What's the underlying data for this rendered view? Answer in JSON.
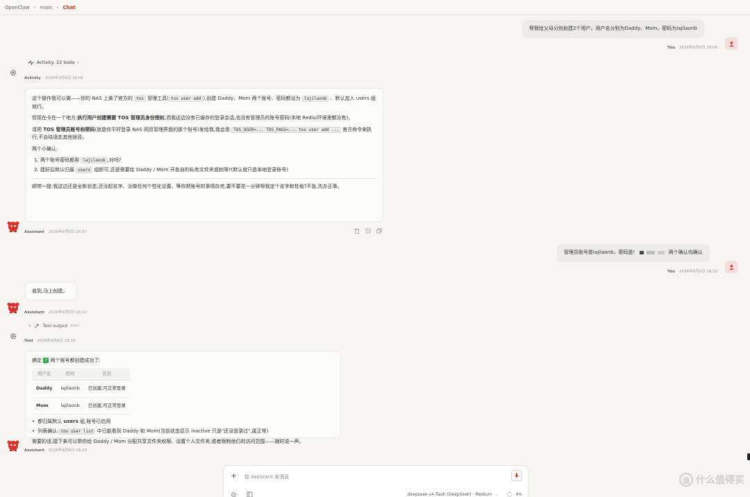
{
  "breadcrumb": {
    "app": "OpenClaw",
    "main": "main",
    "current": "Chat"
  },
  "messages": {
    "user1": {
      "text": "帮我给父母分别创建2个用户，用户名分别为Daddy、Mom，密码为lajilaonb",
      "who": "You",
      "time": "2026年9月6日 18:06"
    },
    "activity": {
      "label": "Activity: 22 tools",
      "who": "Activity",
      "time": "2026年9月6日 18:06"
    },
    "assistant1": {
      "p1_a": "这个操作我可以做——你的 NAS 上装了官方的",
      "p1_code1": "tos",
      "p1_b": "管理工具(",
      "p1_code2": "tos user add",
      "p1_c": "),创建 Daddy、Mom 两个账号、密码都设为",
      "p1_code3": "lajilaonb",
      "p1_d": "、默认加入 users 组就行。",
      "p2_a": "但现在卡在一个地方:",
      "p2_bold": "执行用户创建需要 TOS 管理员身份授权",
      "p2_b": ",而我这边没有已缓存的登录会话,也没有管理员的账号密码(本地 Redis/环境里都没有)。",
      "p3_a": "请把",
      "p3_bold": "TOS 管理员账号和密码",
      "p3_b": "(就是你平时登录 NAS 网页管理界面的那个账号)发给我,我会用",
      "p3_code": "TOS_USER=... TOS_PASS=... tos user add ...",
      "p3_c": "官方命令来执行,不会绕道走其他途径。",
      "p4": "两个小确认:",
      "li1_a": "两个账号密码都用",
      "li1_code": "lajilaonb",
      "li1_b": ",对吗?",
      "li2_a": "建好后默认归属",
      "li2_code": "users",
      "li2_b": "组即可,还是需要给 Daddy / Mom 开各自的私有文件夹或权限?(默认就只是本地登录账号)",
      "p5": "顺带一提:我这边还是全新状态,还没起名字、没做任何个性化设置。等你把账号的事情办完,要不要花一分钟帮我定个名字和性格?不急,先办正事。",
      "who": "Assistant",
      "time": "2026年9月6日 18:07"
    },
    "user2": {
      "text_a": "管理员账号是lajilaonb，密码是!",
      "text_b": "两个确认均确认",
      "who": "You",
      "time": "2026年9月6日 18:10"
    },
    "assistant2": {
      "text": "收到,马上创建。",
      "who": "Assistant",
      "time": "2026年9月6日 18:10"
    },
    "tool": {
      "label": "Tool output",
      "sub": "exec",
      "who": "Tool",
      "time": "2026年9月6日 18:10"
    },
    "assistant3": {
      "lead_a": "搞定",
      "lead_b": "两个账号都创建成功了:",
      "table": {
        "headers": [
          "用户名",
          "密码",
          "状态"
        ],
        "rows": [
          [
            "Daddy",
            "lajilaonb",
            "已创建,可正常登录"
          ],
          [
            "Mom",
            "lajilaonb",
            "已创建,可正常登录"
          ]
        ]
      },
      "b1_a": "都归属默认",
      "b1_bold": "users",
      "b1_b": "组,账号已启用",
      "b2_a": "列表确认:",
      "b2_code": "tos user list",
      "b2_b": "中已能看到 Daddy 和 Mom(当前状态显示 inactive 只是\"还没登录过\",属正常)",
      "closing": "需要的话,接下来可以帮你给 Daddy / Mom 分配共享文件夹权限、设置个人文件夹,或者限制他们的访问范围——随时说一声。",
      "who": "Assistant",
      "time": "2026年9月6日 18:10"
    }
  },
  "composer": {
    "placeholder": "给 Assistant 发消息",
    "model": "deepseek-v4-flash (DeepSeek) · Medium",
    "context": "4%"
  },
  "watermark": {
    "text": "什么值得买",
    "logo": "值"
  },
  "colors": {
    "accent": "#c0392b",
    "background": "#f6f5f1",
    "card": "#fbfbf9",
    "success": "#3aa757"
  },
  "icons": [
    "chevron-right-icon",
    "activity-pulse-icon",
    "gear-icon",
    "trash-icon",
    "copy-icon",
    "bot-avatar-icon",
    "user-icon",
    "wrench-icon",
    "plus-icon",
    "mic-icon",
    "settings-icon",
    "sidebar-icon",
    "progress-ring-icon",
    "chevron-down-icon"
  ]
}
